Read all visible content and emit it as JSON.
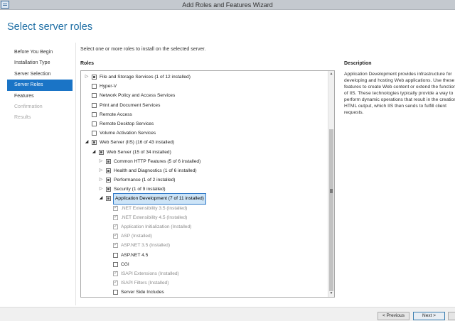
{
  "window": {
    "title": "Add Roles and Features Wizard"
  },
  "page": {
    "heading": "Select server roles",
    "instruction": "Select one or more roles to install on the selected server.",
    "roles_label": "Roles"
  },
  "nav": {
    "items": [
      {
        "label": "Before You Begin",
        "state": "normal"
      },
      {
        "label": "Installation Type",
        "state": "normal"
      },
      {
        "label": "Server Selection",
        "state": "normal"
      },
      {
        "label": "Server Roles",
        "state": "active"
      },
      {
        "label": "Features",
        "state": "normal"
      },
      {
        "label": "Confirmation",
        "state": "disabled"
      },
      {
        "label": "Results",
        "state": "disabled"
      }
    ]
  },
  "roles": {
    "rows": [
      {
        "label": "File and Storage Services (1 of 12 installed)",
        "level": 0,
        "expander": "collapsed",
        "check": "partial",
        "grey": false
      },
      {
        "label": "Hyper-V",
        "level": 0,
        "expander": "none",
        "check": "unchecked",
        "grey": false
      },
      {
        "label": "Network Policy and Access Services",
        "level": 0,
        "expander": "none",
        "check": "unchecked",
        "grey": false
      },
      {
        "label": "Print and Document Services",
        "level": 0,
        "expander": "none",
        "check": "unchecked",
        "grey": false
      },
      {
        "label": "Remote Access",
        "level": 0,
        "expander": "none",
        "check": "unchecked",
        "grey": false
      },
      {
        "label": "Remote Desktop Services",
        "level": 0,
        "expander": "none",
        "check": "unchecked",
        "grey": false
      },
      {
        "label": "Volume Activation Services",
        "level": 0,
        "expander": "none",
        "check": "unchecked",
        "grey": false
      },
      {
        "label": "Web Server (IIS) (16 of 43 installed)",
        "level": 0,
        "expander": "expanded",
        "check": "partial",
        "grey": false
      },
      {
        "label": "Web Server (15 of 34 installed)",
        "level": 1,
        "expander": "expanded",
        "check": "partial",
        "grey": false
      },
      {
        "label": "Common HTTP Features (5 of 6 installed)",
        "level": 2,
        "expander": "collapsed",
        "check": "partial",
        "grey": false
      },
      {
        "label": "Health and Diagnostics (1 of 6 installed)",
        "level": 2,
        "expander": "collapsed",
        "check": "partial",
        "grey": false
      },
      {
        "label": "Performance (1 of 2 installed)",
        "level": 2,
        "expander": "collapsed",
        "check": "partial",
        "grey": false
      },
      {
        "label": "Security (1 of 9 installed)",
        "level": 2,
        "expander": "collapsed",
        "check": "partial",
        "grey": false
      },
      {
        "label": "Application Development (7 of 11 installed)",
        "level": 2,
        "expander": "expanded",
        "check": "partial",
        "grey": false,
        "selected": true
      },
      {
        "label": ".NET Extensibility 3.5 (Installed)",
        "level": 3,
        "expander": "none",
        "check": "checked",
        "grey": true
      },
      {
        "label": ".NET Extensibility 4.5 (Installed)",
        "level": 3,
        "expander": "none",
        "check": "checked",
        "grey": true
      },
      {
        "label": "Application Initialization (Installed)",
        "level": 3,
        "expander": "none",
        "check": "checked",
        "grey": true
      },
      {
        "label": "ASP (Installed)",
        "level": 3,
        "expander": "none",
        "check": "checked",
        "grey": true
      },
      {
        "label": "ASP.NET 3.5 (Installed)",
        "level": 3,
        "expander": "none",
        "check": "checked",
        "grey": true
      },
      {
        "label": "ASP.NET 4.5",
        "level": 3,
        "expander": "none",
        "check": "unchecked",
        "grey": false
      },
      {
        "label": "CGI",
        "level": 3,
        "expander": "none",
        "check": "unchecked",
        "grey": false
      },
      {
        "label": "ISAPI Extensions (Installed)",
        "level": 3,
        "expander": "none",
        "check": "checked",
        "grey": true
      },
      {
        "label": "ISAPI Filters (Installed)",
        "level": 3,
        "expander": "none",
        "check": "checked",
        "grey": true
      },
      {
        "label": "Server Side Includes",
        "level": 3,
        "expander": "none",
        "check": "unchecked",
        "grey": false
      }
    ]
  },
  "description": {
    "title": "Description",
    "text": "Application Development provides infrastructure for developing and hosting Web applications. Use these features to create Web content or extend the functionality of IIS. These technologies typically provide a way to perform dynamic operations that result in the creation of HTML output, which IIS then sends to fulfill client requests."
  },
  "footer": {
    "previous_label": "< Previous",
    "next_label": "Next >"
  }
}
